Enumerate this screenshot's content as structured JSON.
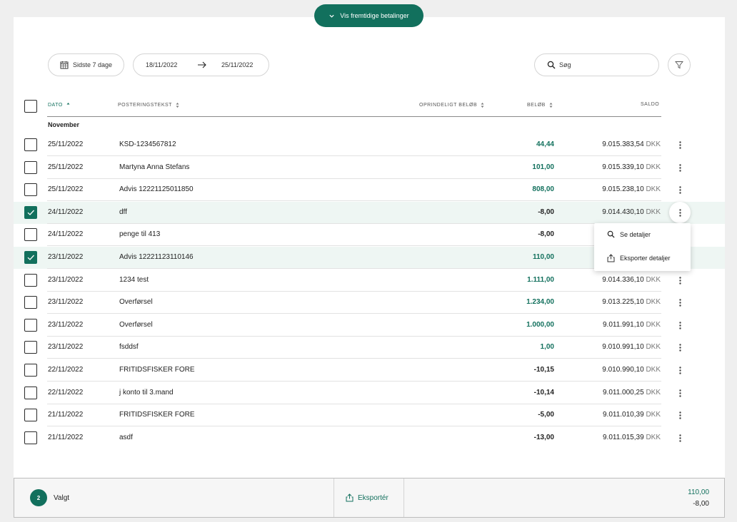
{
  "header": {
    "future_payments_label": "Vis fremtidige betalinger"
  },
  "filters": {
    "period_label": "Sidste 7 dage",
    "date_from": "18/11/2022",
    "date_to": "25/11/2022",
    "search_placeholder": "Søg"
  },
  "columns": {
    "date": "DATO",
    "text": "POSTERINGSTEKST",
    "original": "OPRINDELIGT BELØB",
    "amount": "BELØB",
    "balance": "SALDO"
  },
  "group_label": "November",
  "currency": "DKK",
  "rows": [
    {
      "date": "25/11/2022",
      "text": "KSD-1234567812",
      "amount": "44,44",
      "balance": "9.015.383,54",
      "checked": false,
      "positive": true
    },
    {
      "date": "25/11/2022",
      "text": "Martyna Anna Stefans",
      "amount": "101,00",
      "balance": "9.015.339,10",
      "checked": false,
      "positive": true
    },
    {
      "date": "25/11/2022",
      "text": "Advis 12221125011850",
      "amount": "808,00",
      "balance": "9.015.238,10",
      "checked": false,
      "positive": true
    },
    {
      "date": "24/11/2022",
      "text": "dff",
      "amount": "-8,00",
      "balance": "9.014.430,10",
      "checked": true,
      "positive": false
    },
    {
      "date": "24/11/2022",
      "text": "penge til 413",
      "amount": "-8,00",
      "balance": "",
      "checked": false,
      "positive": false
    },
    {
      "date": "23/11/2022",
      "text": "Advis 12221123110146",
      "amount": "110,00",
      "balance": "",
      "checked": true,
      "positive": true
    },
    {
      "date": "23/11/2022",
      "text": "1234 test",
      "amount": "1.111,00",
      "balance": "9.014.336,10",
      "checked": false,
      "positive": true
    },
    {
      "date": "23/11/2022",
      "text": "Overførsel",
      "amount": "1.234,00",
      "balance": "9.013.225,10",
      "checked": false,
      "positive": true
    },
    {
      "date": "23/11/2022",
      "text": "Overførsel",
      "amount": "1.000,00",
      "balance": "9.011.991,10",
      "checked": false,
      "positive": true
    },
    {
      "date": "23/11/2022",
      "text": "fsddsf",
      "amount": "1,00",
      "balance": "9.010.991,10",
      "checked": false,
      "positive": true
    },
    {
      "date": "22/11/2022",
      "text": "FRITIDSFISKER FORE",
      "amount": "-10,15",
      "balance": "9.010.990,10",
      "checked": false,
      "positive": false
    },
    {
      "date": "22/11/2022",
      "text": "j konto til 3.mand",
      "amount": "-10,14",
      "balance": "9.011.000,25",
      "checked": false,
      "positive": false
    },
    {
      "date": "21/11/2022",
      "text": "FRITIDSFISKER FORE",
      "amount": "-5,00",
      "balance": "9.011.010,39",
      "checked": false,
      "positive": false
    },
    {
      "date": "21/11/2022",
      "text": "asdf",
      "amount": "-13,00",
      "balance": "9.011.015,39",
      "checked": false,
      "positive": false
    }
  ],
  "context_menu": {
    "details_label": "Se detaljer",
    "export_label": "Eksporter detaljer"
  },
  "footer": {
    "selected_count": "2",
    "selected_label": "Valgt",
    "export_label": "Eksportér",
    "sum_positive": "110,00",
    "sum_negative": "-8,00"
  },
  "colors": {
    "accent": "#12705d",
    "selected_row": "#eef6f3"
  }
}
